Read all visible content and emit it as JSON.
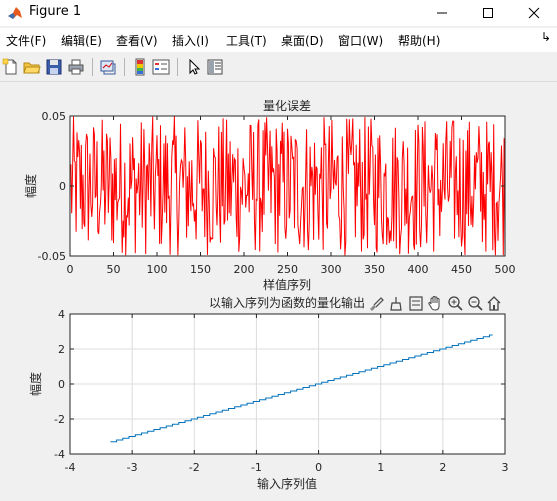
{
  "window": {
    "title": "Figure 1"
  },
  "menu": [
    "文件(F)",
    "编辑(E)",
    "查看(V)",
    "插入(I)",
    "工具(T)",
    "桌面(D)",
    "窗口(W)",
    "帮助(H)"
  ],
  "menu_overflow": "↳",
  "toolbar_icons": [
    "new-figure-icon",
    "open-file-icon",
    "save-icon",
    "print-icon",
    "link-plot-icon",
    "colorbar-icon",
    "legend-icon",
    "pointer-icon",
    "property-inspector-icon"
  ],
  "axes_toolbar_icons": [
    "brush-icon",
    "data-tips-icon",
    "pan-icon",
    "zoom-in-icon",
    "zoom-out-icon",
    "home-icon"
  ],
  "chart_data": [
    {
      "type": "line",
      "title": "量化误差",
      "xlabel": "样值序列",
      "ylabel": "幅度",
      "xlim": [
        0,
        500
      ],
      "ylim": [
        -0.05,
        0.05
      ],
      "xticks": [
        "0",
        "50",
        "100",
        "150",
        "200",
        "250",
        "300",
        "350",
        "400",
        "450",
        "500"
      ],
      "yticks": [
        "-0.05",
        "0",
        "0.05"
      ],
      "series": [
        {
          "color": "#ff0000",
          "n_points": 500,
          "distribution": "uniform",
          "range": [
            -0.05,
            0.05
          ]
        }
      ],
      "grid": false
    },
    {
      "type": "line",
      "title": "以输入序列为函数的量化输出",
      "xlabel": "输入序列值",
      "ylabel": "幅度",
      "xlim": [
        -4,
        3
      ],
      "ylim": [
        -4,
        4
      ],
      "xticks": [
        "-4",
        "-3",
        "-2",
        "-1",
        "0",
        "1",
        "2",
        "3"
      ],
      "yticks": [
        "-4",
        "-2",
        "0",
        "2",
        "4"
      ],
      "series": [
        {
          "color": "#0072bd",
          "x": [
            -3.35,
            2.8
          ],
          "y": [
            -3.35,
            2.8
          ],
          "quantization_step": 0.1
        }
      ],
      "grid": true
    }
  ]
}
